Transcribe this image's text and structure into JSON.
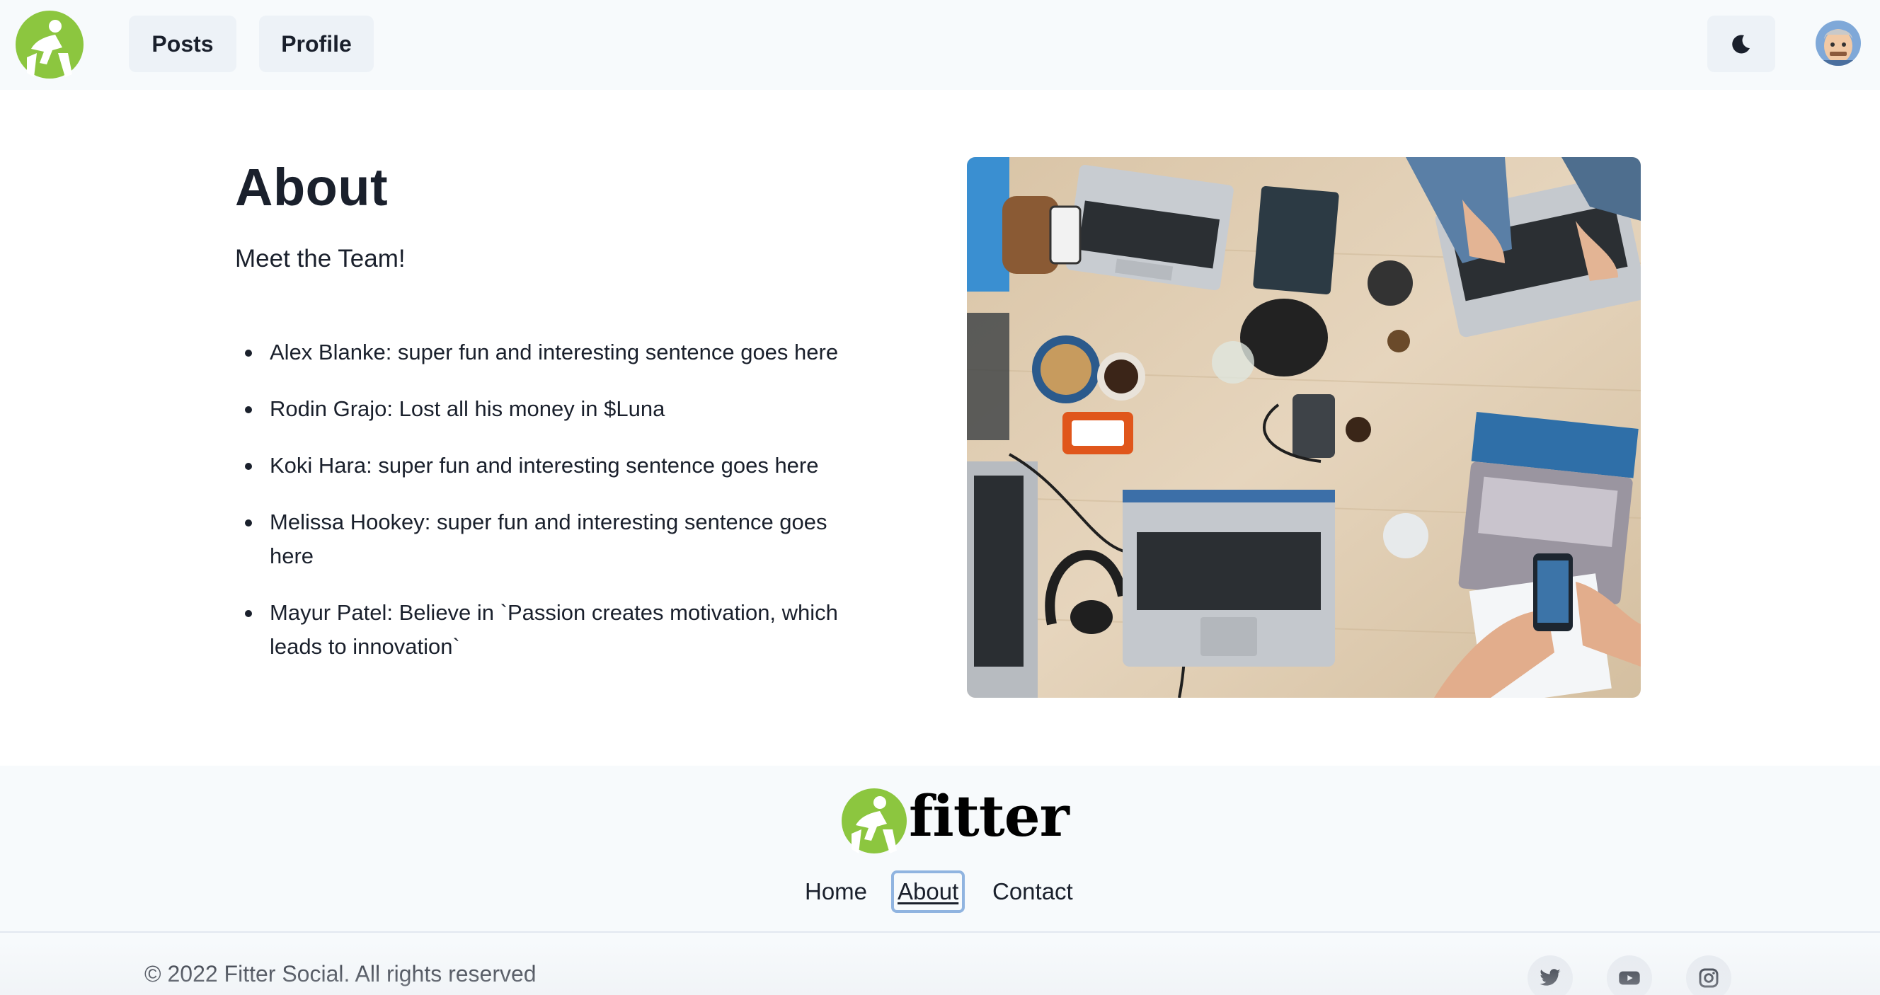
{
  "header": {
    "nav": [
      {
        "label": "Posts"
      },
      {
        "label": "Profile"
      }
    ],
    "theme_toggle_icon": "moon-icon",
    "avatar_icon": "user-avatar"
  },
  "main": {
    "title": "About",
    "subtitle": "Meet the Team!",
    "team": [
      "Alex Blanke: super fun and interesting sentence goes here",
      "Rodin Grajo: Lost all his money in $Luna",
      "Koki Hara: super fun and interesting sentence goes here",
      "Melissa Hookey: super fun and interesting sentence goes here",
      "Mayur Patel: Believe in `Passion creates motivation, which leads to innovation`"
    ],
    "photo_icon": "team-workspace-photo"
  },
  "footer": {
    "wordmark": "fitter",
    "links": [
      {
        "label": "Home"
      },
      {
        "label": "About"
      },
      {
        "label": "Contact"
      }
    ],
    "copyright": "© 2022 Fitter Social. All rights reserved",
    "social": [
      "twitter-icon",
      "youtube-icon",
      "instagram-icon"
    ]
  },
  "colors": {
    "brand_green": "#8cc63f",
    "header_bg": "#f7fafc",
    "button_bg": "#edf2f7",
    "text": "#1a202c",
    "focus_outline": "#90b4e0"
  }
}
